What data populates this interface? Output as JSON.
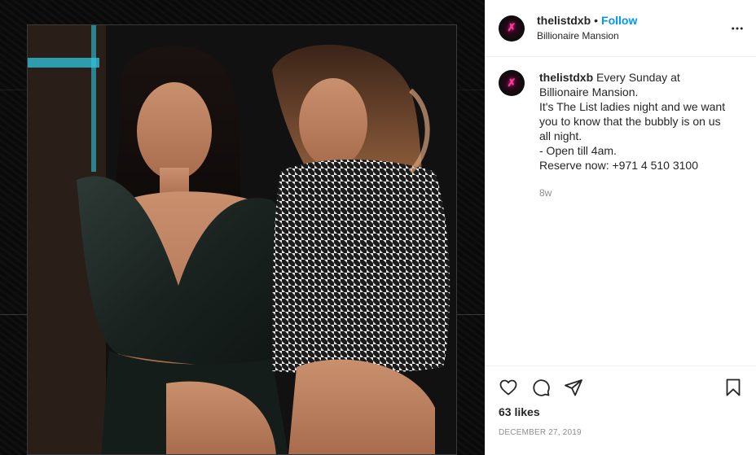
{
  "post": {
    "username": "thelistdxb",
    "separator": "•",
    "follow_label": "Follow",
    "location": "Billionaire Mansion",
    "caption_lines": [
      "Every Sunday at Billionaire Mansion.",
      "It's The List ladies night and we want you to know that the bubbly is on us all night.",
      "- Open till 4am.",
      "Reserve now: +971 4 510 3100"
    ],
    "age": "8w",
    "likes": "63 likes",
    "date": "DECEMBER 27, 2019"
  },
  "icons": {
    "more": "more-options-icon",
    "like": "heart-icon",
    "comment": "comment-icon",
    "share": "send-icon",
    "save": "bookmark-icon"
  },
  "colors": {
    "accent": "#0095f6",
    "brand_pink": "#ff3ca0",
    "text": "#262626",
    "muted": "#8e8e8e",
    "divider": "#efefef"
  }
}
